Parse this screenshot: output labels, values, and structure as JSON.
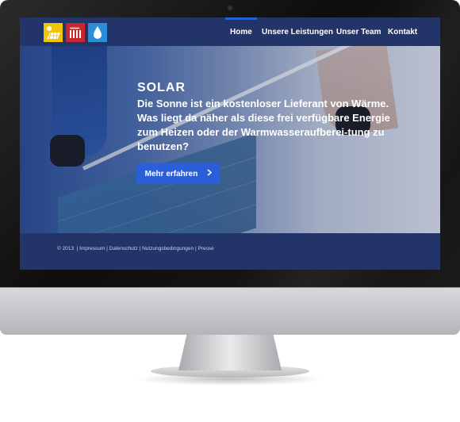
{
  "nav": {
    "items": [
      {
        "label": "Home",
        "active": true
      },
      {
        "label": "Unsere Leistungen",
        "active": false
      },
      {
        "label": "Unser Team",
        "active": false
      },
      {
        "label": "Kontakt",
        "active": false
      }
    ]
  },
  "logos": [
    {
      "icon": "solar-panel-icon",
      "color": "#f4c400"
    },
    {
      "icon": "radiator-icon",
      "color": "#c8282b"
    },
    {
      "icon": "water-drop-icon",
      "color": "#2a8fd8"
    }
  ],
  "hero": {
    "title": "SOLAR",
    "text": "Die Sonne ist ein kostenloser Lieferant von Wärme. Was liegt da näher als diese frei verfügbare Energie zum Heizen oder der Warmwasseraufberei-tung zu benutzen?",
    "cta_label": "Mehr erfahren",
    "slides": 4,
    "active_slide": 2
  },
  "footer": {
    "copyright": "© 2013",
    "links": [
      "Impressum",
      "Datenschutz",
      "Nutzungsbedingungen",
      "Presse"
    ]
  },
  "colors": {
    "header_bg": "#233468",
    "accent": "#2b5fd9"
  }
}
